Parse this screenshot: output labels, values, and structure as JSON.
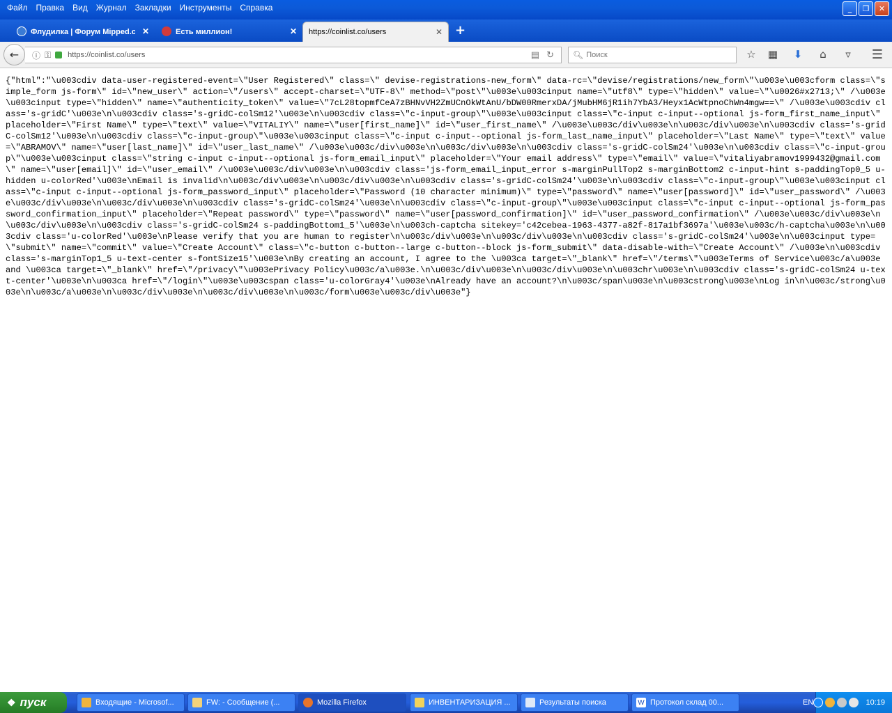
{
  "menu": {
    "items": [
      "Файл",
      "Правка",
      "Вид",
      "Журнал",
      "Закладки",
      "Инструменты",
      "Справка"
    ]
  },
  "window_controls": {
    "minimize": "_",
    "maximize": "❐",
    "close": "✕"
  },
  "tabs": [
    {
      "label": "Флудилка | Форум Mipped.c...",
      "close": "✕"
    },
    {
      "label": "Есть миллион!",
      "close": "✕"
    },
    {
      "label": "https://coinlist.co/users",
      "close": "✕"
    }
  ],
  "newtab_symbol": "+",
  "navbar": {
    "url": "https://coinlist.co/users",
    "search_placeholder": "Поиск"
  },
  "content": {
    "raw_json": "{\"html\":\"\\u003cdiv data-user-registered-event=\\\"User Registered\\\" class=\\\" devise-registrations-new_form\\\" data-rc=\\\"devise/registrations/new_form\\\"\\u003e\\u003cform class=\\\"simple_form js-form\\\" id=\\\"new_user\\\" action=\\\"/users\\\" accept-charset=\\\"UTF-8\\\" method=\\\"post\\\"\\u003e\\u003cinput name=\\\"utf8\\\" type=\\\"hidden\\\" value=\\\"\\u0026#x2713;\\\" /\\u003e\\u003cinput type=\\\"hidden\\\" name=\\\"authenticity_token\\\" value=\\\"7cL28topmfCeA7zBHNvVH2ZmUCnOkWtAnU/bDW00RmerxDA/jMubHM6jR1ih7YbA3/Heyx1AcWtpnoChWn4mgw==\\\" /\\u003e\\u003cdiv class='s-gridC'\\u003e\\n\\u003cdiv class='s-gridC-colSm12'\\u003e\\n\\u003cdiv class=\\\"c-input-group\\\"\\u003e\\u003cinput class=\\\"c-input c-input--optional js-form_first_name_input\\\" placeholder=\\\"First Name\\\" type=\\\"text\\\" value=\\\"VITALIY\\\" name=\\\"user[first_name]\\\" id=\\\"user_first_name\\\" /\\u003e\\u003c/div\\u003e\\n\\u003c/div\\u003e\\n\\u003cdiv class='s-gridC-colSm12'\\u003e\\n\\u003cdiv class=\\\"c-input-group\\\"\\u003e\\u003cinput class=\\\"c-input c-input--optional js-form_last_name_input\\\" placeholder=\\\"Last Name\\\" type=\\\"text\\\" value=\\\"ABRAMOV\\\" name=\\\"user[last_name]\\\" id=\\\"user_last_name\\\" /\\u003e\\u003c/div\\u003e\\n\\u003c/div\\u003e\\n\\u003cdiv class='s-gridC-colSm24'\\u003e\\n\\u003cdiv class=\\\"c-input-group\\\"\\u003e\\u003cinput class=\\\"string c-input c-input--optional js-form_email_input\\\" placeholder=\\\"Your email address\\\" type=\\\"email\\\" value=\\\"vitaliyabramov1999432@gmail.com\\\" name=\\\"user[email]\\\" id=\\\"user_email\\\" /\\u003e\\u003c/div\\u003e\\n\\u003cdiv class='js-form_email_input_error s-marginPullTop2 s-marginBottom2 c-input-hint s-paddingTop0_5 u-hidden u-colorRed'\\u003e\\nEmail is invalid\\n\\u003c/div\\u003e\\n\\u003c/div\\u003e\\n\\u003cdiv class='s-gridC-colSm24'\\u003e\\n\\u003cdiv class=\\\"c-input-group\\\"\\u003e\\u003cinput class=\\\"c-input c-input--optional js-form_password_input\\\" placeholder=\\\"Password (10 character minimum)\\\" type=\\\"password\\\" name=\\\"user[password]\\\" id=\\\"user_password\\\" /\\u003e\\u003c/div\\u003e\\n\\u003c/div\\u003e\\n\\u003cdiv class='s-gridC-colSm24'\\u003e\\n\\u003cdiv class=\\\"c-input-group\\\"\\u003e\\u003cinput class=\\\"c-input c-input--optional js-form_password_confirmation_input\\\" placeholder=\\\"Repeat password\\\" type=\\\"password\\\" name=\\\"user[password_confirmation]\\\" id=\\\"user_password_confirmation\\\" /\\u003e\\u003c/div\\u003e\\n\\u003c/div\\u003e\\n\\u003cdiv class='s-gridC-colSm24 s-paddingBottom1_5'\\u003e\\n\\u003ch-captcha sitekey='c42cebea-1963-4377-a82f-817a1bf3697a'\\u003e\\u003c/h-captcha\\u003e\\n\\u003cdiv class='u-colorRed'\\u003e\\nPlease verify that you are human to register\\n\\u003c/div\\u003e\\n\\u003c/div\\u003e\\n\\u003cdiv class='s-gridC-colSm24'\\u003e\\n\\u003cinput type=\\\"submit\\\" name=\\\"commit\\\" value=\\\"Create Account\\\" class=\\\"c-button c-button--large c-button--block js-form_submit\\\" data-disable-with=\\\"Create Account\\\" /\\u003e\\n\\u003cdiv class='s-marginTop1_5 u-text-center s-fontSize15'\\u003e\\nBy creating an account, I agree to the \\u003ca target=\\\"_blank\\\" href=\\\"/terms\\\"\\u003eTerms of Service\\u003c/a\\u003e and \\u003ca target=\\\"_blank\\\" href=\\\"/privacy\\\"\\u003ePrivacy Policy\\u003c/a\\u003e.\\n\\u003c/div\\u003e\\n\\u003c/div\\u003e\\n\\u003chr\\u003e\\n\\u003cdiv class='s-gridC-colSm24 u-text-center'\\u003e\\n\\u003ca href=\\\"/login\\\"\\u003e\\u003cspan class='u-colorGray4'\\u003e\\nAlready have an account?\\n\\u003c/span\\u003e\\n\\u003cstrong\\u003e\\nLog in\\n\\u003c/strong\\u003e\\n\\u003c/a\\u003e\\n\\u003c/div\\u003e\\n\\u003c/div\\u003e\\n\\u003c/form\\u003e\\u003c/div\\u003e\"}"
  },
  "taskbar": {
    "start_label": "пуск",
    "tasks": [
      {
        "label": "Входящие - Microsof...",
        "icon": "outlook-icon"
      },
      {
        "label": "FW: - Сообщение (...",
        "icon": "mail-icon"
      },
      {
        "label": "Mozilla Firefox",
        "icon": "firefox-icon"
      },
      {
        "label": "ИНВЕНТАРИЗАЦИЯ ...",
        "icon": "folder-icon"
      },
      {
        "label": "Результаты поиска",
        "icon": "search-results-icon"
      },
      {
        "label": "Протокол склад 00...",
        "icon": "word-icon"
      }
    ],
    "language": "EN",
    "clock": "10:19"
  }
}
